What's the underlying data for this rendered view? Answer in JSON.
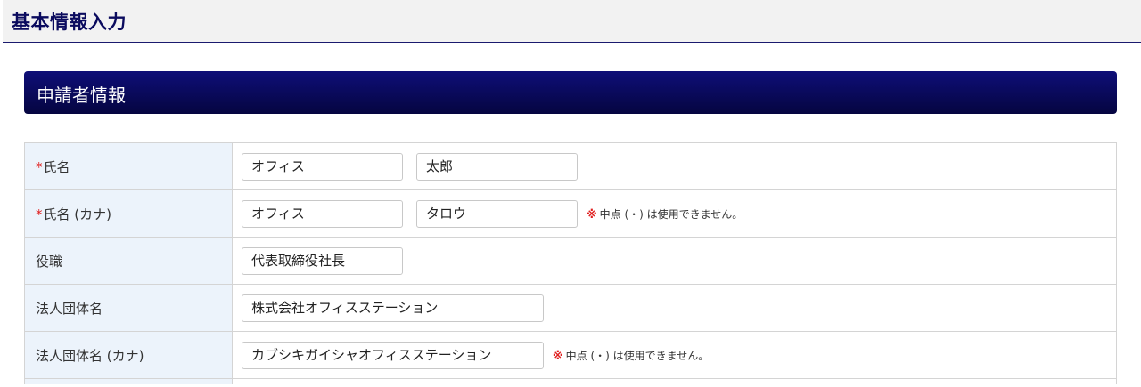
{
  "header": {
    "title": "基本情報入力"
  },
  "section": {
    "title": "申請者情報"
  },
  "rows": [
    {
      "required": true,
      "label": "氏名",
      "inputs": [
        "オフィス",
        "太郎"
      ]
    },
    {
      "required": true,
      "label": "氏名 (カナ)",
      "inputs": [
        "オフィス",
        "タロウ"
      ],
      "note": "中点 (・) は使用できません。"
    },
    {
      "required": false,
      "label": "役職",
      "inputs": [
        "代表取締役社長"
      ]
    },
    {
      "required": false,
      "label": "法人団体名",
      "inputs": [
        "株式会社オフィスステーション"
      ]
    },
    {
      "required": false,
      "label": "法人団体名 (カナ)",
      "inputs": [
        "カブシキガイシャオフィスステーション"
      ],
      "note": "中点 (・) は使用できません。"
    }
  ],
  "marks": {
    "required": "*",
    "note": "※"
  },
  "colors": {
    "header_title": "#0b0b5e",
    "section_bar": "#0a0a5c",
    "label_bg": "#ecf3fb",
    "required": "#e02020"
  }
}
